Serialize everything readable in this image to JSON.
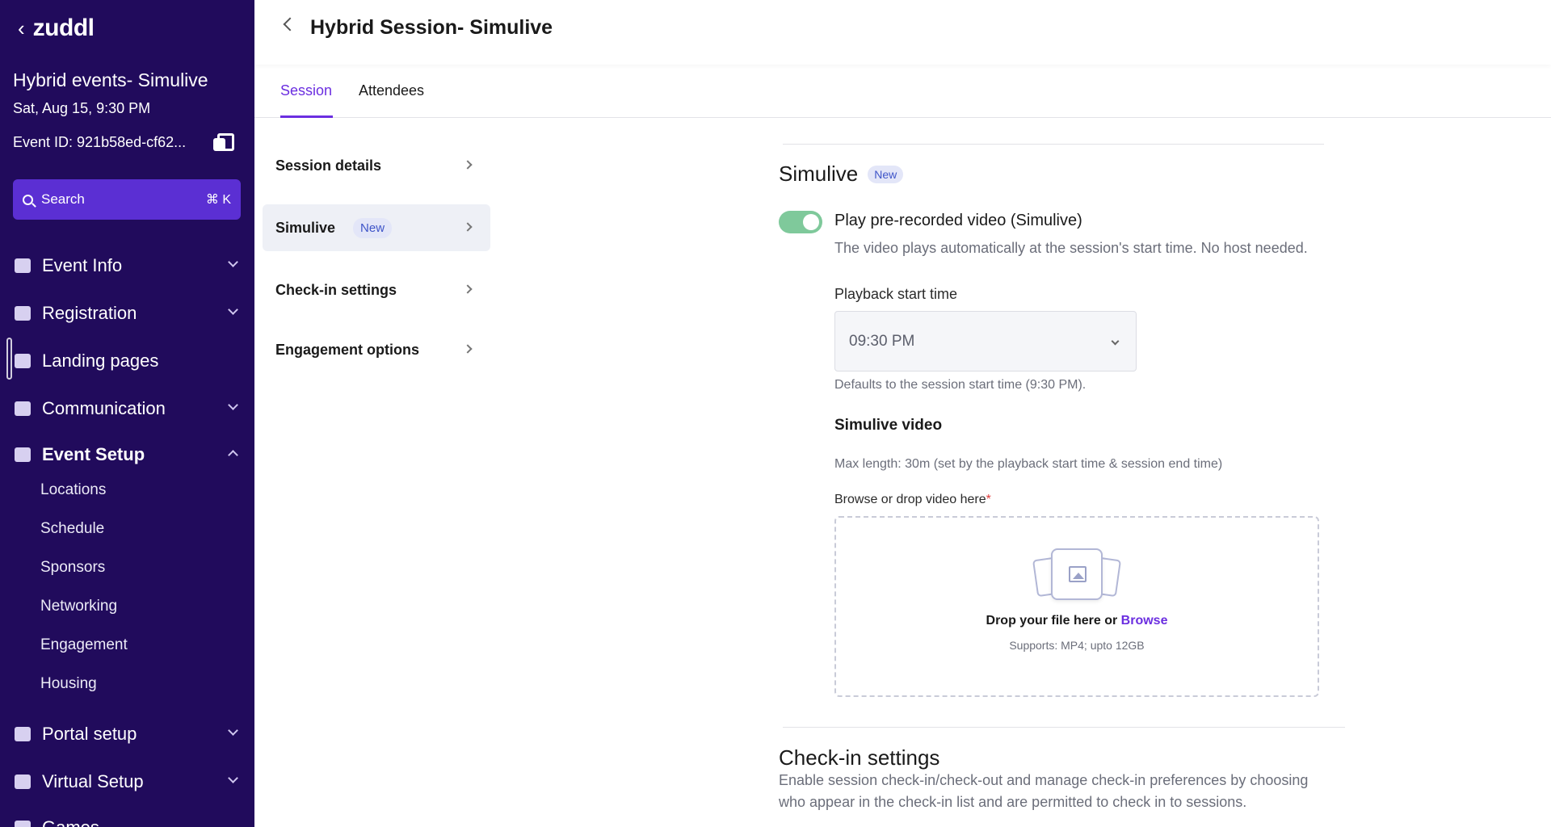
{
  "sidebar": {
    "logo": "zuddl",
    "event_title": "Hybrid events- Simulive",
    "event_date": "Sat, Aug 15, 9:30 PM",
    "event_id": "Event ID: 921b58ed-cf62...",
    "search_label": "Search",
    "search_shortcut": "⌘ K",
    "nav": [
      {
        "label": "Event Info"
      },
      {
        "label": "Registration"
      },
      {
        "label": "Landing pages"
      },
      {
        "label": "Communication"
      },
      {
        "label": "Event Setup"
      },
      {
        "label": "Portal setup"
      },
      {
        "label": "Virtual Setup"
      },
      {
        "label": "Games"
      }
    ],
    "event_setup_children": [
      "Locations",
      "Schedule",
      "Sponsors",
      "Networking",
      "Engagement",
      "Housing"
    ]
  },
  "header": {
    "title": "Hybrid Session- Simulive"
  },
  "tabs": [
    {
      "label": "Session"
    },
    {
      "label": "Attendees"
    }
  ],
  "subnav": [
    {
      "label": "Session details"
    },
    {
      "label": "Simulive",
      "badge": "New"
    },
    {
      "label": "Check-in settings"
    },
    {
      "label": "Engagement options"
    }
  ],
  "simulive": {
    "title": "Simulive",
    "badge": "New",
    "toggle_label": "Play pre-recorded video (Simulive)",
    "toggle_on": true,
    "toggle_desc": "The video plays automatically at the session's start time. No host needed.",
    "playback_label": "Playback start time",
    "playback_value": "09:30 PM",
    "playback_hint": "Defaults to the session start time (9:30 PM).",
    "video_title": "Simulive video",
    "video_maxlen": "Max length: 30m (set by the playback start time & session end time)",
    "drop_label": "Browse or drop video here",
    "drop_required": "*",
    "drop_text": "Drop your file here or",
    "drop_browse": "Browse",
    "drop_supports": "Supports: MP4; upto 12GB"
  },
  "checkin": {
    "title": "Check-in settings",
    "desc_line1": "Enable session check-in/check-out and manage check-in preferences by choosing",
    "desc_line2": "who appear in the check-in list and are permitted to check in to sessions."
  },
  "colors": {
    "sidebar_bg": "#210b5c",
    "accent": "#6b2ee0",
    "toggle_on": "#7fc99b"
  }
}
